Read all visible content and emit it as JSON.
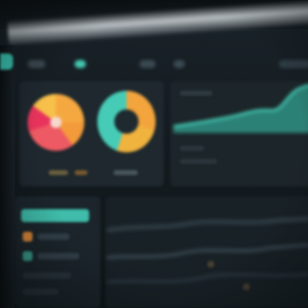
{
  "theme": {
    "background": "#141c21",
    "accent_teal": "#43c7b0",
    "accent_orange": "#f3a43c",
    "accent_red": "#e8345c",
    "panel": "#1e282e"
  },
  "sidebar": {
    "active_icon": "dashboard-icon"
  },
  "top_nav": {
    "items": [
      "",
      "",
      "",
      ""
    ],
    "active_index": 1
  },
  "widgets": {
    "donut_1": {
      "icon": "pie-chart-icon",
      "slices": [
        "orange",
        "red",
        "yellow"
      ]
    },
    "donut_2": {
      "icon": "donut-chart-icon",
      "slices": [
        "orange",
        "yellow",
        "teal"
      ]
    },
    "area_chart": {
      "icon": "area-chart-icon",
      "color": "#43c7b0"
    },
    "list_panel": {
      "icon": "list-icon"
    },
    "line_chart": {
      "icon": "line-chart-icon"
    }
  }
}
